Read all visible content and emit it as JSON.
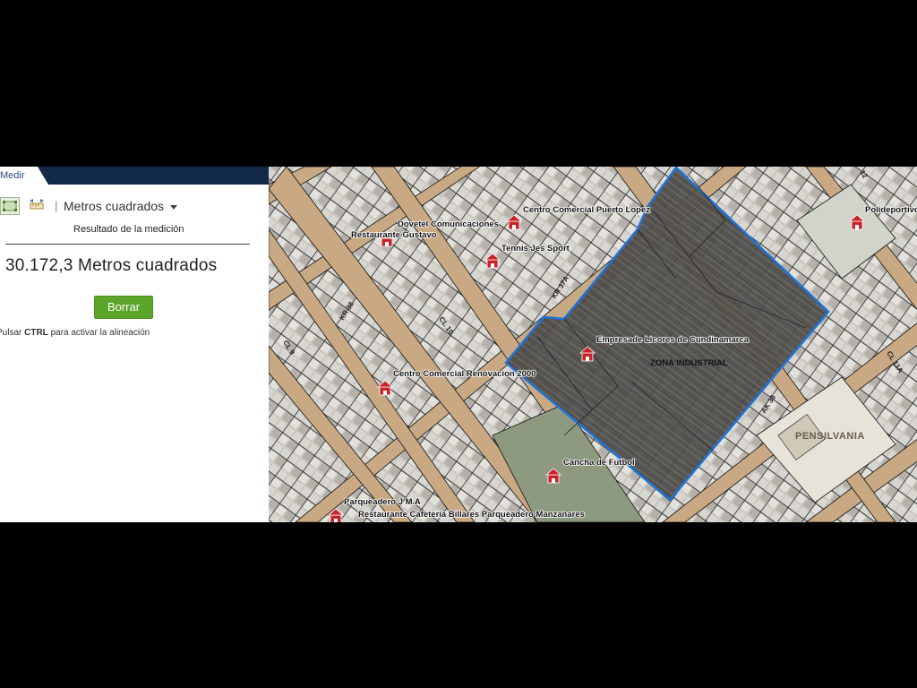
{
  "panel": {
    "tab_label": "Medir",
    "tools": {
      "area_icon": "area-measure-icon",
      "distance_icon": "distance-measure-icon"
    },
    "separator": "|",
    "unit_selected": "Metros cuadrados",
    "result_label": "Resultado de la medición",
    "result_value": "30.172,3 Metros cuadrados",
    "clear_label": "Borrar",
    "hint_prefix": "Pulsar ",
    "hint_key": "CTRL",
    "hint_suffix": " para activar la alineación"
  },
  "map": {
    "poi_icon": "building-poi-icon",
    "pois": [
      "Dovetel Comunicaciones",
      "Restaurante Gustavo",
      "Centro Comercial Puerto Lopez",
      "Tennis Jes Sport",
      "Polideportivo",
      "Empresade Licores de Cundinamarca",
      "Centro Comercial Renovacion 2000",
      "Cancha de Futbol",
      "Parqueadero J M A",
      "Restaurante Cafeteria Billares Parqueadero Manzanares"
    ],
    "streets": [
      "KR 38",
      "CL 10",
      "CL 9",
      "KR 37A",
      "AK 36",
      "CL 11A",
      "12"
    ],
    "zones": [
      "ZONA INDUSTRIAL",
      "PENSILVANIA"
    ],
    "colors": {
      "measure_outline": "#1e73d8",
      "measure_fill": "#3a3a3a",
      "button_green": "#5aa52a",
      "header_navy": "#12294a"
    }
  }
}
